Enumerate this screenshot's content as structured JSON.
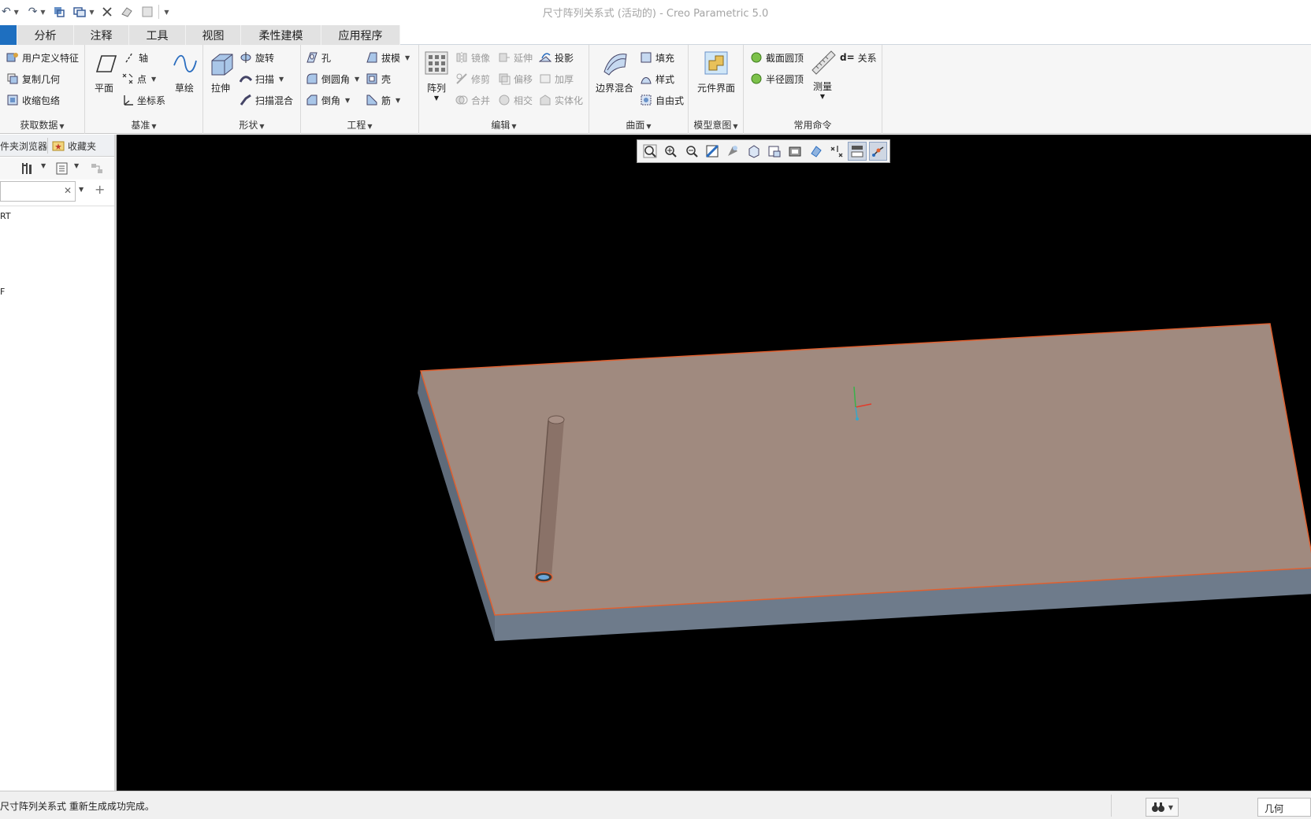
{
  "window": {
    "title": "尺寸阵列关系式 (活动的) - Creo Parametric 5.0"
  },
  "tabs": [
    {
      "label": "",
      "active": true
    },
    {
      "label": "分析"
    },
    {
      "label": "注释"
    },
    {
      "label": "工具"
    },
    {
      "label": "视图"
    },
    {
      "label": "柔性建模"
    },
    {
      "label": "应用程序"
    }
  ],
  "ribbon": {
    "get_data": {
      "label": "获取数据",
      "items": [
        "用户定义特征",
        "复制几何",
        "收缩包络"
      ]
    },
    "datum": {
      "label": "基准",
      "plane": "平面",
      "axis": "轴",
      "point": "点",
      "csys": "坐标系",
      "sketch": "草绘"
    },
    "shapes": {
      "label": "形状",
      "extrude": "拉伸",
      "revolve": "旋转",
      "sweep": "扫描",
      "swept_blend": "扫描混合"
    },
    "engineering": {
      "label": "工程",
      "hole": "孔",
      "draft": "拔模",
      "round": "倒圆角",
      "shell": "壳",
      "chamfer": "倒角",
      "rib": "筋"
    },
    "editing": {
      "label": "编辑",
      "pattern": "阵列",
      "mirror": "镜像",
      "extend": "延伸",
      "project": "投影",
      "trim": "修剪",
      "offset": "偏移",
      "thicken": "加厚",
      "merge": "合并",
      "intersect": "相交",
      "solidify": "实体化"
    },
    "surfaces": {
      "label": "曲面",
      "boundary_blend": "边界混合",
      "fill": "填充",
      "style": "样式",
      "freestyle": "自由式"
    },
    "model_intent": {
      "label": "模型意图",
      "component_interface": "元件界面"
    },
    "common": {
      "label": "常用命令",
      "section_dome": "截面圆顶",
      "radius_dome": "半径圆顶",
      "measure": "测量",
      "relations": "关系"
    }
  },
  "navigator": {
    "tabs": [
      "文件夹浏览器",
      "收藏夹"
    ],
    "tree": [
      "RT",
      "F"
    ]
  },
  "status": {
    "message": "尺寸阵列关系式 重新生成成功完成。",
    "filter": "几何"
  },
  "colors": {
    "accent": "#1e6fc0",
    "part_top": "#a08a7f",
    "part_side": "#6c7a89",
    "edge": "#e06030"
  }
}
